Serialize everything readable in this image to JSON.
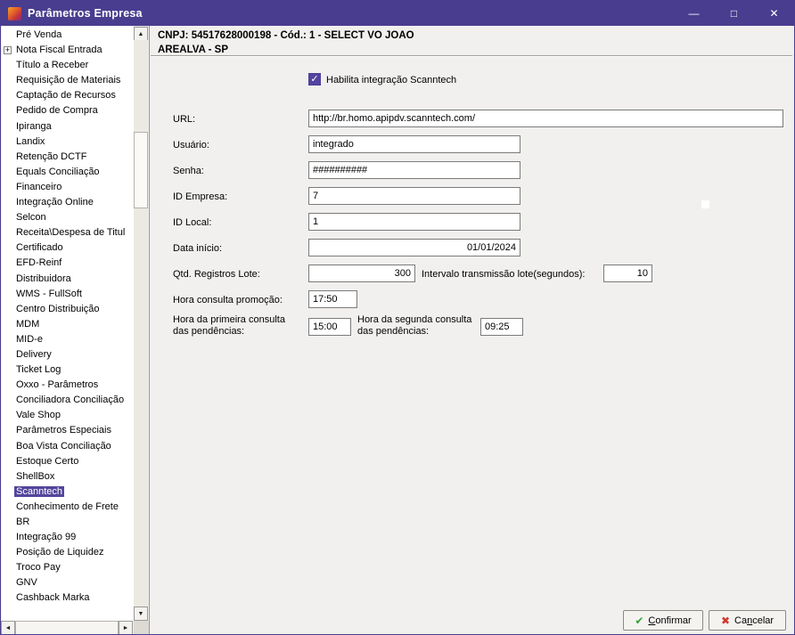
{
  "window": {
    "title": "Parâmetros Empresa",
    "controls": {
      "minimize": "—",
      "maximize": "□",
      "close": "✕"
    }
  },
  "icons": {
    "up": "▲",
    "down": "▼",
    "left": "◄",
    "right": "►",
    "plus": "+",
    "checkmark": "✓",
    "confirm_check": "✔",
    "cancel_x": "✖"
  },
  "sidebar": {
    "items": [
      {
        "label": "Pré Venda"
      },
      {
        "label": "Nota Fiscal Entrada",
        "expandable": true
      },
      {
        "label": "Título a Receber"
      },
      {
        "label": "Requisição de Materiais"
      },
      {
        "label": "Captação de Recursos"
      },
      {
        "label": "Pedido de Compra"
      },
      {
        "label": "Ipiranga"
      },
      {
        "label": "Landix"
      },
      {
        "label": "Retenção DCTF"
      },
      {
        "label": "Equals Conciliação"
      },
      {
        "label": "Financeiro"
      },
      {
        "label": "Integração Online"
      },
      {
        "label": "Selcon"
      },
      {
        "label": "Receita\\Despesa de Titul"
      },
      {
        "label": "Certificado"
      },
      {
        "label": "EFD-Reinf"
      },
      {
        "label": "Distribuidora"
      },
      {
        "label": "WMS - FullSoft"
      },
      {
        "label": "Centro Distribuição"
      },
      {
        "label": "MDM"
      },
      {
        "label": "MID-e"
      },
      {
        "label": "Delivery"
      },
      {
        "label": "Ticket Log"
      },
      {
        "label": "Oxxo - Parâmetros"
      },
      {
        "label": "Conciliadora Conciliação"
      },
      {
        "label": "Vale Shop"
      },
      {
        "label": "Parâmetros Especiais"
      },
      {
        "label": "Boa Vista Conciliação"
      },
      {
        "label": "Estoque Certo"
      },
      {
        "label": "ShellBox"
      },
      {
        "label": "Scanntech",
        "selected": true
      },
      {
        "label": "Conhecimento de Frete"
      },
      {
        "label": "BR"
      },
      {
        "label": "Integração 99"
      },
      {
        "label": "Posição de Liquidez"
      },
      {
        "label": "Troco Pay"
      },
      {
        "label": "GNV"
      },
      {
        "label": "Cashback Marka"
      }
    ]
  },
  "header": {
    "line1": "CNPJ: 54517628000198 - Cód.: 1 - SELECT VO JOAO",
    "line2": "AREALVA - SP"
  },
  "form": {
    "enable": {
      "label": "Habilita integração Scanntech",
      "checked": true
    },
    "url": {
      "label": "URL:",
      "value": "http://br.homo.apipdv.scanntech.com/"
    },
    "usuario": {
      "label": "Usuário:",
      "value": "integrado"
    },
    "senha": {
      "label": "Senha:",
      "value": "##########"
    },
    "id_empresa": {
      "label": "ID Empresa:",
      "value": "7"
    },
    "id_local": {
      "label": "ID Local:",
      "value": "1"
    },
    "data_inicio": {
      "label": "Data início:",
      "value": "01/01/2024"
    },
    "qtd_registros": {
      "label": "Qtd. Registros Lote:",
      "value": "300"
    },
    "intervalo": {
      "label": "Intervalo transmissão lote(segundos):",
      "value": "10"
    },
    "hora_promocao": {
      "label": "Hora consulta promoção:",
      "value": "17:50"
    },
    "hora_primeira": {
      "label": "Hora da primeira consulta das pendências:",
      "value": "15:00"
    },
    "hora_segunda": {
      "label": "Hora da segunda consulta das pendências:",
      "value": "09:25"
    }
  },
  "footer": {
    "confirm": {
      "pre": "",
      "mnemonic": "C",
      "post": "onfirmar"
    },
    "cancel": {
      "pre": "Ca",
      "mnemonic": "n",
      "post": "celar"
    }
  }
}
